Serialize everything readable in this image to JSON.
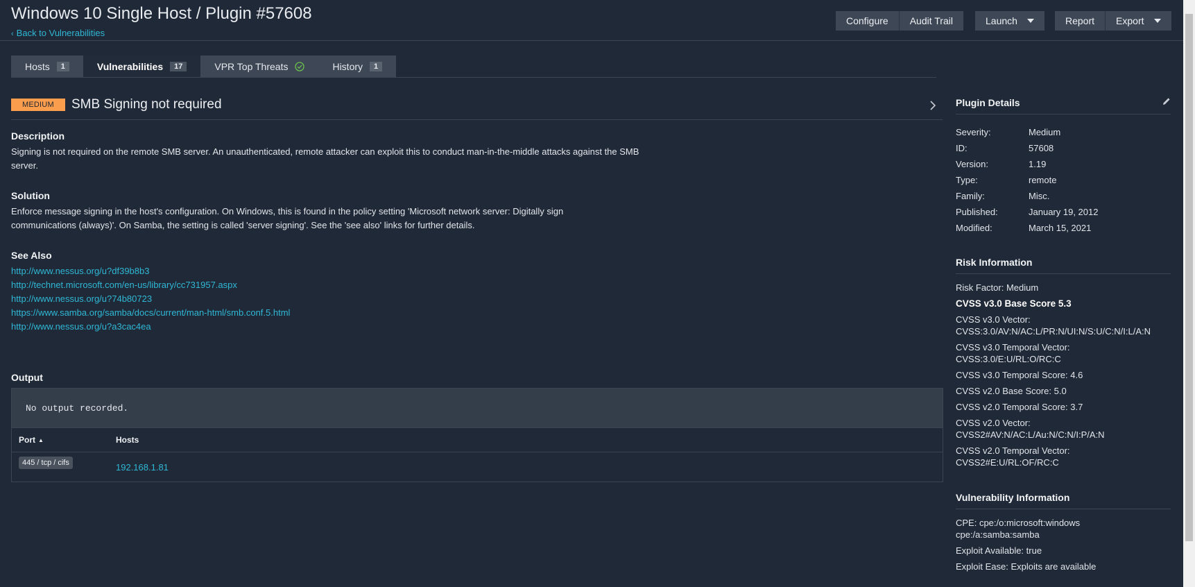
{
  "header": {
    "title": "Windows 10 Single Host / Plugin #57608",
    "back_link": "Back to Vulnerabilities",
    "buttons": {
      "configure": "Configure",
      "audit_trail": "Audit Trail",
      "launch": "Launch",
      "report": "Report",
      "export": "Export"
    }
  },
  "tabs": [
    {
      "label": "Hosts",
      "count": "1"
    },
    {
      "label": "Vulnerabilities",
      "count": "17"
    },
    {
      "label": "VPR Top Threats",
      "icon": "check-circle-icon"
    },
    {
      "label": "History",
      "count": "1"
    }
  ],
  "vuln": {
    "severity": "MEDIUM",
    "severity_color": "#fa9d4d",
    "title": "SMB Signing not required",
    "description_title": "Description",
    "description": "Signing is not required on the remote SMB server. An unauthenticated, remote attacker can exploit this to conduct man-in-the-middle attacks against the SMB server.",
    "solution_title": "Solution",
    "solution": "Enforce message signing in the host's configuration. On Windows, this is found in the policy setting 'Microsoft network server: Digitally sign communications (always)'. On Samba, the setting is called 'server signing'. See the 'see also' links for further details.",
    "see_also_title": "See Also",
    "see_also": [
      "http://www.nessus.org/u?df39b8b3",
      "http://technet.microsoft.com/en-us/library/cc731957.aspx",
      "http://www.nessus.org/u?74b80723",
      "https://www.samba.org/samba/docs/current/man-html/smb.conf.5.html",
      "http://www.nessus.org/u?a3cac4ea"
    ],
    "output_title": "Output",
    "output_text": "No output recorded.",
    "table": {
      "col_port": "Port",
      "col_hosts": "Hosts",
      "rows": [
        {
          "port": "445 / tcp / cifs",
          "host": "192.168.1.81"
        }
      ]
    }
  },
  "plugin_details": {
    "title": "Plugin Details",
    "rows": [
      {
        "k": "Severity:",
        "v": "Medium"
      },
      {
        "k": "ID:",
        "v": "57608"
      },
      {
        "k": "Version:",
        "v": "1.19"
      },
      {
        "k": "Type:",
        "v": "remote"
      },
      {
        "k": "Family:",
        "v": "Misc."
      },
      {
        "k": "Published:",
        "v": "January 19, 2012"
      },
      {
        "k": "Modified:",
        "v": "March 15, 2021"
      }
    ]
  },
  "risk": {
    "title": "Risk Information",
    "lines": [
      "Risk Factor: Medium",
      "CVSS v3.0 Base Score 5.3",
      "CVSS v3.0 Vector: CVSS:3.0/AV:N/AC:L/PR:N/UI:N/S:U/C:N/I:L/A:N",
      "CVSS v3.0 Temporal Vector: CVSS:3.0/E:U/RL:O/RC:C",
      "CVSS v3.0 Temporal Score: 4.6",
      "CVSS v2.0 Base Score: 5.0",
      "CVSS v2.0 Temporal Score: 3.7",
      "CVSS v2.0 Vector: CVSS2#AV:N/AC:L/Au:N/C:N/I:P/A:N",
      "CVSS v2.0 Temporal Vector: CVSS2#E:U/RL:OF/RC:C"
    ]
  },
  "vuln_info": {
    "title": "Vulnerability Information",
    "lines": [
      "CPE: cpe:/o:microsoft:windows cpe:/a:samba:samba",
      "Exploit Available: true",
      "Exploit Ease: Exploits are available"
    ]
  }
}
